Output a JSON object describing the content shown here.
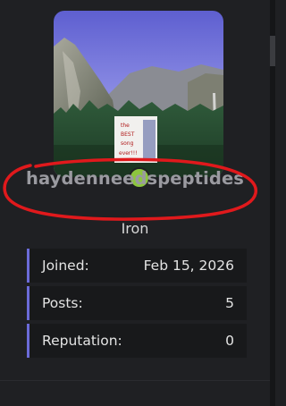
{
  "profile": {
    "avatar_caption_lines": [
      "the",
      "BEST",
      "song",
      "ever!!!"
    ],
    "username": "haydenneedspeptides",
    "user_title": "Iron",
    "online": true,
    "online_color": "#8dc63f"
  },
  "stats": [
    {
      "label": "Joined:",
      "value": "Feb 15, 2026"
    },
    {
      "label": "Posts:",
      "value": "5"
    },
    {
      "label": "Reputation:",
      "value": "0"
    }
  ],
  "colors": {
    "background": "#1f2023",
    "stat_accent": "#6b6bd8",
    "annotation": "#e0191c"
  }
}
